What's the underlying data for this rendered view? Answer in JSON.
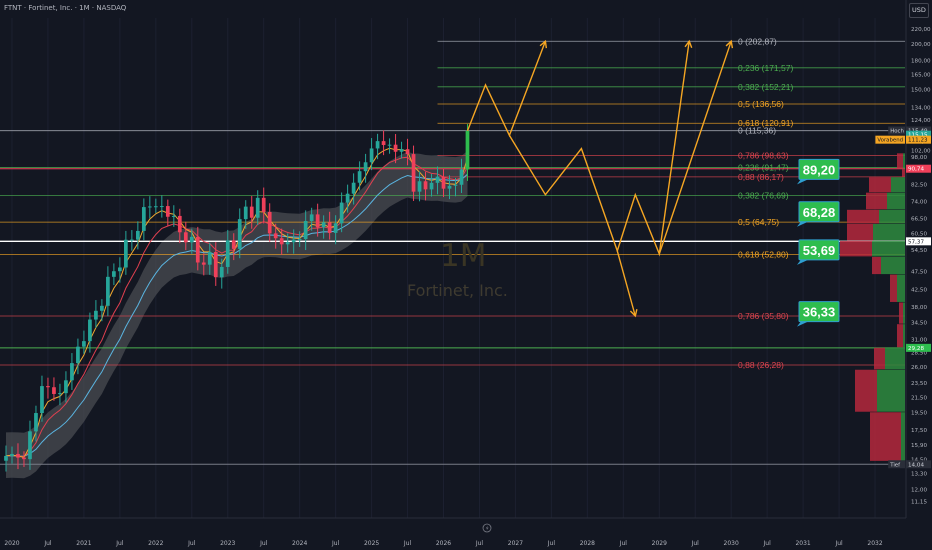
{
  "header": {
    "title": "FTNT · Fortinet, Inc. · 1M · NASDAQ",
    "currency": "USD"
  },
  "watermark": {
    "interval": "1M",
    "name": "Fortinet, Inc."
  },
  "colors": {
    "up": "#26a69a",
    "upBright": "#2ebd4e",
    "down": "#f0405a",
    "orange": "#f5a623",
    "green": "#4caf50",
    "red": "#e0454f",
    "white": "#ffffff",
    "ema1": "#f0a830",
    "ema2": "#e04050",
    "ema3": "#5ab4e0"
  },
  "chart_data": {
    "type": "candlestick",
    "y_scale": "log",
    "ylim": [
      10,
      235
    ],
    "y_ticks": [
      "11,15",
      "12,00",
      "13,30",
      "14,50",
      "15,90",
      "17,50",
      "19,50",
      "21,50",
      "23,50",
      "26,00",
      "28,50",
      "31,00",
      "34,50",
      "38,00",
      "42,50",
      "47,50",
      "54,50",
      "60,50",
      "66,50",
      "74,00",
      "82,50",
      "92,00",
      "98,00",
      "102,00",
      "108,00",
      "115,00",
      "124,00",
      "134,00",
      "150,00",
      "165,00",
      "180,00",
      "200,00",
      "220,00"
    ],
    "x_range": [
      "2019-11",
      "2032-06"
    ],
    "x_ticks": [
      {
        "label": "2020",
        "date": "2020-01"
      },
      {
        "label": "Jul",
        "date": "2020-07"
      },
      {
        "label": "2021",
        "date": "2021-01"
      },
      {
        "label": "Jul",
        "date": "2021-07"
      },
      {
        "label": "2022",
        "date": "2022-01"
      },
      {
        "label": "Jul",
        "date": "2022-07"
      },
      {
        "label": "2023",
        "date": "2023-01"
      },
      {
        "label": "Jul",
        "date": "2023-07"
      },
      {
        "label": "2024",
        "date": "2024-01"
      },
      {
        "label": "Jul",
        "date": "2024-07"
      },
      {
        "label": "2025",
        "date": "2025-01"
      },
      {
        "label": "Jul",
        "date": "2025-07"
      },
      {
        "label": "2026",
        "date": "2026-01"
      },
      {
        "label": "Jul",
        "date": "2026-07"
      },
      {
        "label": "2027",
        "date": "2027-01"
      },
      {
        "label": "Jul",
        "date": "2027-07"
      },
      {
        "label": "2028",
        "date": "2028-01"
      },
      {
        "label": "Jul",
        "date": "2028-07"
      },
      {
        "label": "2029",
        "date": "2029-01"
      },
      {
        "label": "Jul",
        "date": "2029-07"
      },
      {
        "label": "2030",
        "date": "2030-01"
      },
      {
        "label": "Jul",
        "date": "2030-07"
      },
      {
        "label": "2031",
        "date": "2031-01"
      },
      {
        "label": "Jul",
        "date": "2031-07"
      },
      {
        "label": "2032",
        "date": "2032-01"
      }
    ],
    "anchors": [
      [
        "2019-12",
        14.8
      ],
      [
        "2020-03",
        14.5
      ],
      [
        "2020-06",
        23.0
      ],
      [
        "2020-09",
        22.0
      ],
      [
        "2020-12",
        29.5
      ],
      [
        "2021-03",
        37.0
      ],
      [
        "2021-06",
        47.5
      ],
      [
        "2021-09",
        58.0
      ],
      [
        "2021-12",
        71.5
      ],
      [
        "2022-03",
        67.0
      ],
      [
        "2022-06",
        57.0
      ],
      [
        "2022-09",
        49.5
      ],
      [
        "2022-12",
        48.8
      ],
      [
        "2023-03",
        66.0
      ],
      [
        "2023-06",
        75.5
      ],
      [
        "2023-09",
        58.5
      ],
      [
        "2023-12",
        58.0
      ],
      [
        "2024-03",
        68.0
      ],
      [
        "2024-06",
        60.5
      ],
      [
        "2024-09",
        77.5
      ],
      [
        "2024-12",
        94.5
      ],
      [
        "2025-02",
        108.0
      ],
      [
        "2025-05",
        101.0
      ],
      [
        "2025-07",
        99.5
      ],
      [
        "2025-08",
        78.5
      ],
      [
        "2025-11",
        83.0
      ],
      [
        "2026-01",
        80.0
      ],
      [
        "2026-03",
        82.0
      ],
      [
        "2026-04",
        90.3
      ],
      [
        "2026-05",
        115.3
      ]
    ],
    "fib_levels": [
      {
        "label": "0 (202,87)",
        "value": 202.87,
        "color": "#b2b5be",
        "from": "2025-12",
        "to": "2032-06"
      },
      {
        "label": "0,236 (171,57)",
        "value": 171.57,
        "color": "#4caf50",
        "from": "2025-12",
        "to": "2032-06"
      },
      {
        "label": "0,382 (152,21)",
        "value": 152.21,
        "color": "#4caf50",
        "from": "2025-12",
        "to": "2032-06"
      },
      {
        "label": "0,5 (136,56)",
        "value": 136.56,
        "color": "#f5a623",
        "from": "2025-12",
        "to": "2032-06"
      },
      {
        "label": "0,618 (120,91)",
        "value": 120.91,
        "color": "#f5a623",
        "from": "2025-12",
        "to": "2032-06"
      },
      {
        "label": "0 (115,36)",
        "value": 115.36,
        "color": "#b2b5be",
        "from": "2019-11",
        "to": "2032-06"
      },
      {
        "label": "0,786 (98,63)",
        "value": 98.63,
        "color": "#e0454f",
        "from": "2025-12",
        "to": "2032-06"
      },
      {
        "label": "0,236 (91,47)",
        "value": 91.47,
        "color": "#4caf50",
        "from": "2019-11",
        "to": "2032-06"
      },
      {
        "label": "0,88 (86,17)",
        "value": 86.17,
        "color": "#e0454f",
        "from": "2025-12",
        "to": "2032-06"
      },
      {
        "label": "0,382 (76,69)",
        "value": 76.69,
        "color": "#4caf50",
        "from": "2019-11",
        "to": "2032-06"
      },
      {
        "label": "0,5 (64,75)",
        "value": 64.75,
        "color": "#f5a623",
        "from": "2019-11",
        "to": "2032-06"
      },
      {
        "label": "0,618 (52,80)",
        "value": 52.8,
        "color": "#f5a623",
        "from": "2019-11",
        "to": "2032-06"
      },
      {
        "label": "0,786 (35,80)",
        "value": 35.8,
        "color": "#e0454f",
        "from": "2019-11",
        "to": "2032-06"
      },
      {
        "label": "0,88 (26,28)",
        "value": 26.28,
        "color": "#e0454f",
        "from": "2019-11",
        "to": "2032-06"
      }
    ],
    "horizontal_lines": [
      {
        "value": 90.74,
        "color": "#f0405a"
      },
      {
        "value": 57.37,
        "color": "#ffffff"
      },
      {
        "value": 29.28,
        "color": "#4caf50"
      },
      {
        "value": 14.04,
        "color": "#787b86"
      }
    ],
    "forecast_path": [
      [
        [
          "2026-05",
          115.3
        ],
        [
          "2026-08",
          154.0
        ],
        [
          "2026-12",
          112.0
        ],
        [
          "2027-06",
          203.0
        ]
      ],
      [
        [
          "2026-12",
          112.0
        ],
        [
          "2027-06",
          77.0
        ],
        [
          "2027-12",
          103.0
        ],
        [
          "2028-06",
          54.0
        ],
        [
          "2028-09",
          77.0
        ],
        [
          "2029-01",
          53.0
        ],
        [
          "2029-06",
          203.0
        ]
      ],
      [
        [
          "2029-01",
          53.0
        ],
        [
          "2030-01",
          203.0
        ]
      ],
      [
        [
          "2028-06",
          54.0
        ],
        [
          "2028-09",
          35.8
        ]
      ]
    ],
    "callouts": [
      {
        "label": "89,20",
        "value": 89.2
      },
      {
        "label": "68,28",
        "value": 68.28
      },
      {
        "label": "53,69",
        "value": 53.69
      },
      {
        "label": "36,33",
        "value": 36.33
      }
    ],
    "price_tags": [
      {
        "label": "Hoch",
        "value": 115.49,
        "bg": "#2a2e39",
        "fg": "#d1d4dc"
      },
      {
        "label": "115,49",
        "value": 115.49,
        "bg": "#2a2e39",
        "fg": "#d1d4dc"
      },
      {
        "label": "115,15",
        "value": 112.5,
        "bg": "#26a69a",
        "fg": "#ffffff"
      },
      {
        "label": "Vorabend",
        "value": 109.0,
        "bg": "#f5a623",
        "fg": "#131722"
      },
      {
        "label": "111,23",
        "value": 109.0,
        "bg": "#f5a623",
        "fg": "#131722"
      },
      {
        "label": "90,74",
        "value": 90.74,
        "bg": "#f0405a",
        "fg": "#ffffff"
      },
      {
        "label": "57,37",
        "value": 57.37,
        "bg": "#ffffff",
        "fg": "#131722"
      },
      {
        "label": "29,28",
        "value": 29.28,
        "bg": "#2ebd4e",
        "fg": "#ffffff"
      },
      {
        "label": "Tief",
        "value": 14.04,
        "bg": "#2a2e39",
        "fg": "#d1d4dc"
      },
      {
        "label": "14,04",
        "value": 14.04,
        "bg": "#2a2e39",
        "fg": "#d1d4dc"
      }
    ],
    "volume_profile": [
      {
        "from": 90.5,
        "to": 100,
        "up": 2,
        "down": 6
      },
      {
        "from": 86,
        "to": 90.5,
        "up": 0,
        "down": 3
      },
      {
        "from": 78,
        "to": 86,
        "up": 14,
        "down": 22
      },
      {
        "from": 70,
        "to": 78,
        "up": 18,
        "down": 21
      },
      {
        "from": 64,
        "to": 70,
        "up": 26,
        "down": 32
      },
      {
        "from": 57.5,
        "to": 64,
        "up": 32,
        "down": 26
      },
      {
        "from": 52,
        "to": 57.5,
        "up": 33,
        "down": 32
      },
      {
        "from": 46.5,
        "to": 52,
        "up": 24,
        "down": 9
      },
      {
        "from": 39,
        "to": 46.5,
        "up": 8,
        "down": 7
      },
      {
        "from": 34,
        "to": 39,
        "up": 2,
        "down": 4
      },
      {
        "from": 29.3,
        "to": 34,
        "up": 2,
        "down": 6
      },
      {
        "from": 25.5,
        "to": 29.3,
        "up": 20,
        "down": 11
      },
      {
        "from": 19.5,
        "to": 25.5,
        "up": 28,
        "down": 22
      },
      {
        "from": 14.3,
        "to": 19.5,
        "up": 4,
        "down": 31
      }
    ]
  }
}
